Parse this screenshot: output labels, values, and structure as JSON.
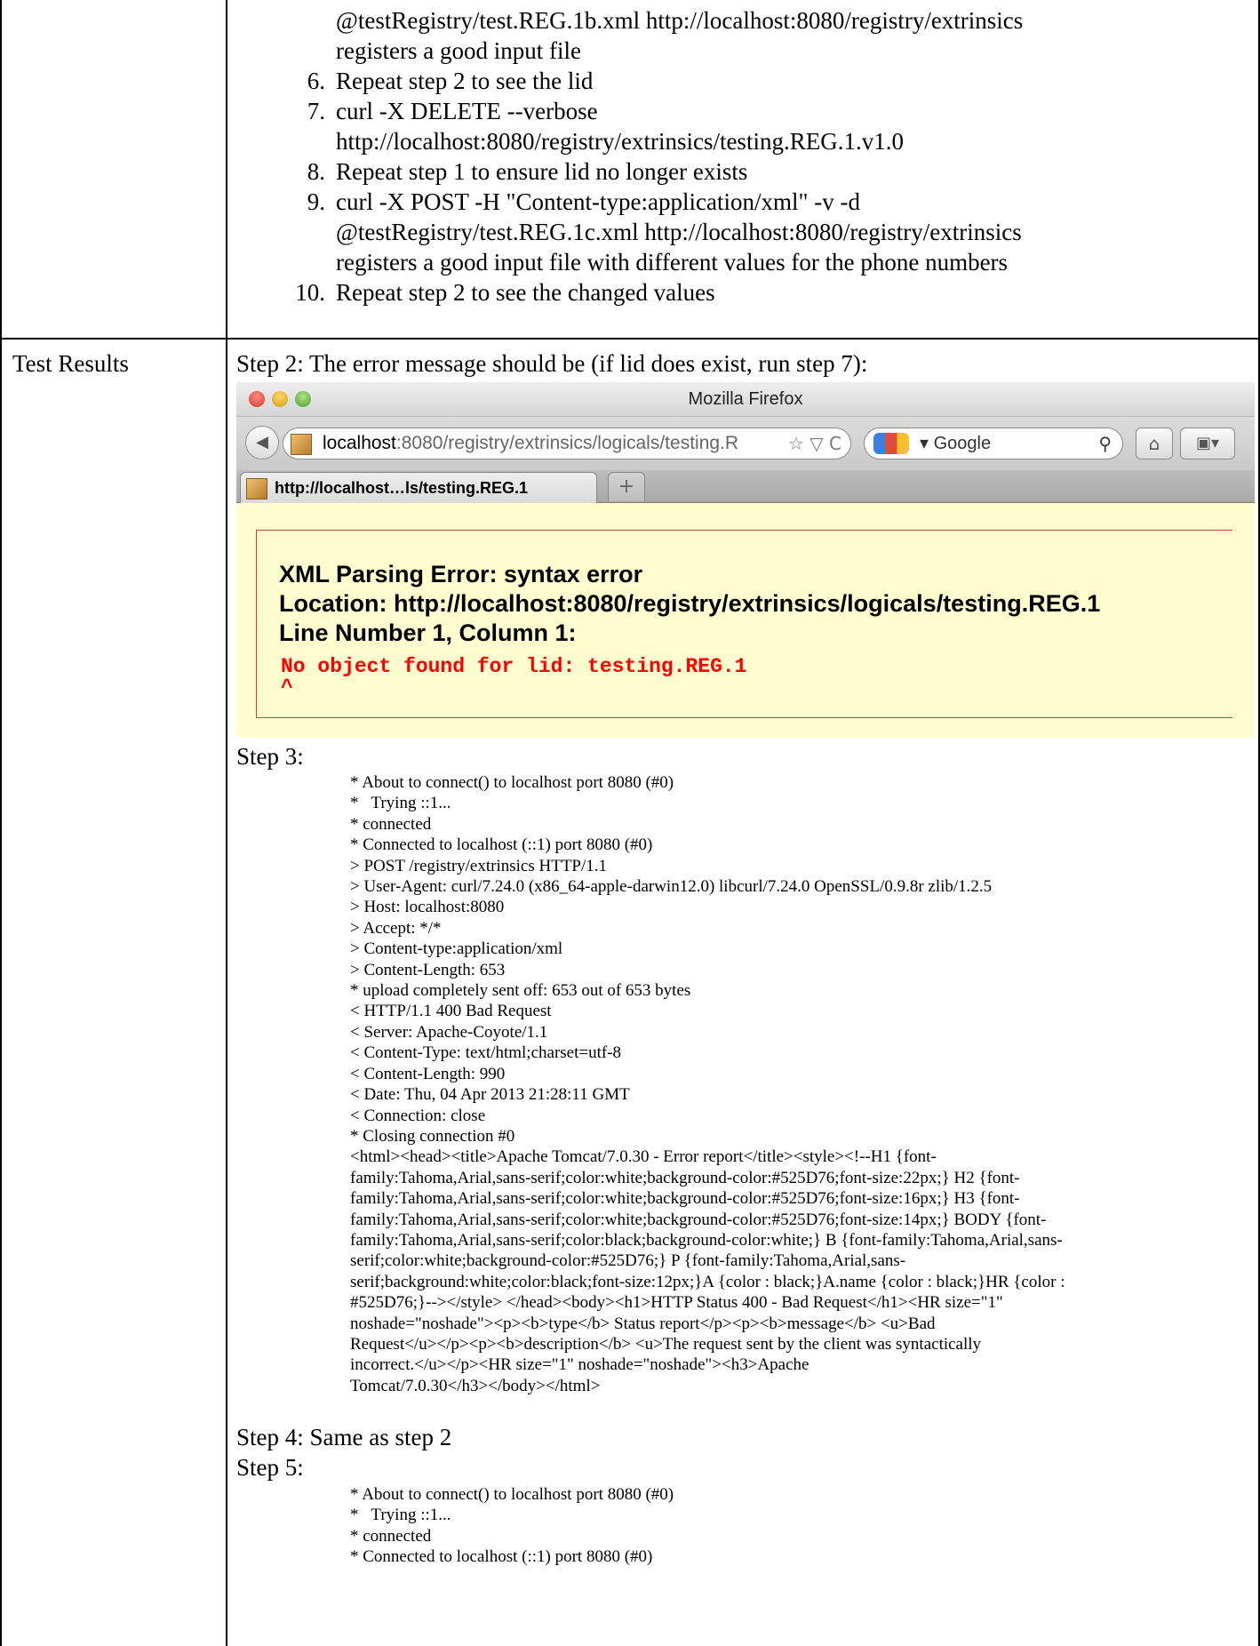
{
  "steps_intro": [
    {
      "num": "",
      "lines": [
        "@testRegistry/test.REG.1b.xml http://localhost:8080/registry/extrinsics",
        "registers a good input file"
      ]
    },
    {
      "num": "6.",
      "lines": [
        "Repeat step 2 to see the lid"
      ]
    },
    {
      "num": "7.",
      "lines": [
        "curl -X DELETE --verbose",
        "http://localhost:8080/registry/extrinsics/testing.REG.1.v1.0"
      ]
    },
    {
      "num": "8.",
      "lines": [
        "Repeat step 1 to ensure lid no longer exists"
      ]
    },
    {
      "num": "9.",
      "lines": [
        "curl -X POST -H \"Content-type:application/xml\" -v -d",
        "@testRegistry/test.REG.1c.xml http://localhost:8080/registry/extrinsics",
        "registers a good input file with different values for the phone numbers"
      ]
    },
    {
      "num": "10.",
      "lines": [
        "Repeat step 2 to see the changed values"
      ]
    }
  ],
  "results_label": "Test Results",
  "step2_text": "Step 2: The error message should be (if lid does exist, run step 7):",
  "firefox": {
    "window_title": "Mozilla Firefox",
    "url_host": "localhost",
    "url_rest": ":8080/registry/extrinsics/logicals/testing.R",
    "url_icons": "☆ ▽ C",
    "search_text": "▾ Google",
    "tab_title": "http://localhost…ls/testing.REG.1",
    "newtab": "+",
    "home_icon": "⌂",
    "bookmark_icon": "▣▾",
    "back_icon": "◀",
    "error_heading_1": "XML Parsing Error: syntax error",
    "error_heading_2": "Location: http://localhost:8080/registry/extrinsics/logicals/testing.REG.1",
    "error_heading_3": "Line Number 1, Column 1:",
    "error_message": "No object found for lid: testing.REG.1",
    "error_caret": "^",
    "colors": {
      "error_bg": "#fffdd0",
      "error_text": "#ff0000",
      "border": "#c84040"
    }
  },
  "step3_label": "Step 3:",
  "step3_log": [
    "* About to connect() to localhost port 8080 (#0)",
    "*   Trying ::1...",
    "* connected",
    "* Connected to localhost (::1) port 8080 (#0)",
    "> POST /registry/extrinsics HTTP/1.1",
    "> User-Agent: curl/7.24.0 (x86_64-apple-darwin12.0) libcurl/7.24.0 OpenSSL/0.9.8r zlib/1.2.5",
    "> Host: localhost:8080",
    "> Accept: */*",
    "> Content-type:application/xml",
    "> Content-Length: 653",
    "* upload completely sent off: 653 out of 653 bytes",
    "< HTTP/1.1 400 Bad Request",
    "< Server: Apache-Coyote/1.1",
    "< Content-Type: text/html;charset=utf-8",
    "< Content-Length: 990",
    "< Date: Thu, 04 Apr 2013 21:28:11 GMT",
    "< Connection: close",
    "* Closing connection #0",
    "<html><head><title>Apache Tomcat/7.0.30 - Error report</title><style><!--H1 {font-",
    "family:Tahoma,Arial,sans-serif;color:white;background-color:#525D76;font-size:22px;} H2 {font-",
    "family:Tahoma,Arial,sans-serif;color:white;background-color:#525D76;font-size:16px;} H3 {font-",
    "family:Tahoma,Arial,sans-serif;color:white;background-color:#525D76;font-size:14px;} BODY {font-",
    "family:Tahoma,Arial,sans-serif;color:black;background-color:white;} B {font-family:Tahoma,Arial,sans-",
    "serif;color:white;background-color:#525D76;} P {font-family:Tahoma,Arial,sans-",
    "serif;background:white;color:black;font-size:12px;}A {color : black;}A.name {color : black;}HR {color :",
    "#525D76;}--></style> </head><body><h1>HTTP Status 400 - Bad Request</h1><HR size=\"1\"",
    "noshade=\"noshade\"><p><b>type</b> Status report</p><p><b>message</b> <u>Bad",
    "Request</u></p><p><b>description</b> <u>The request sent by the client was syntactically",
    "incorrect.</u></p><HR size=\"1\" noshade=\"noshade\"><h3>Apache",
    "Tomcat/7.0.30</h3></body></html>"
  ],
  "step4_text": "Step 4: Same as step 2",
  "step5_label": "Step 5:",
  "step5_log": [
    "* About to connect() to localhost port 8080 (#0)",
    "*   Trying ::1...",
    "* connected",
    "* Connected to localhost (::1) port 8080 (#0)"
  ]
}
